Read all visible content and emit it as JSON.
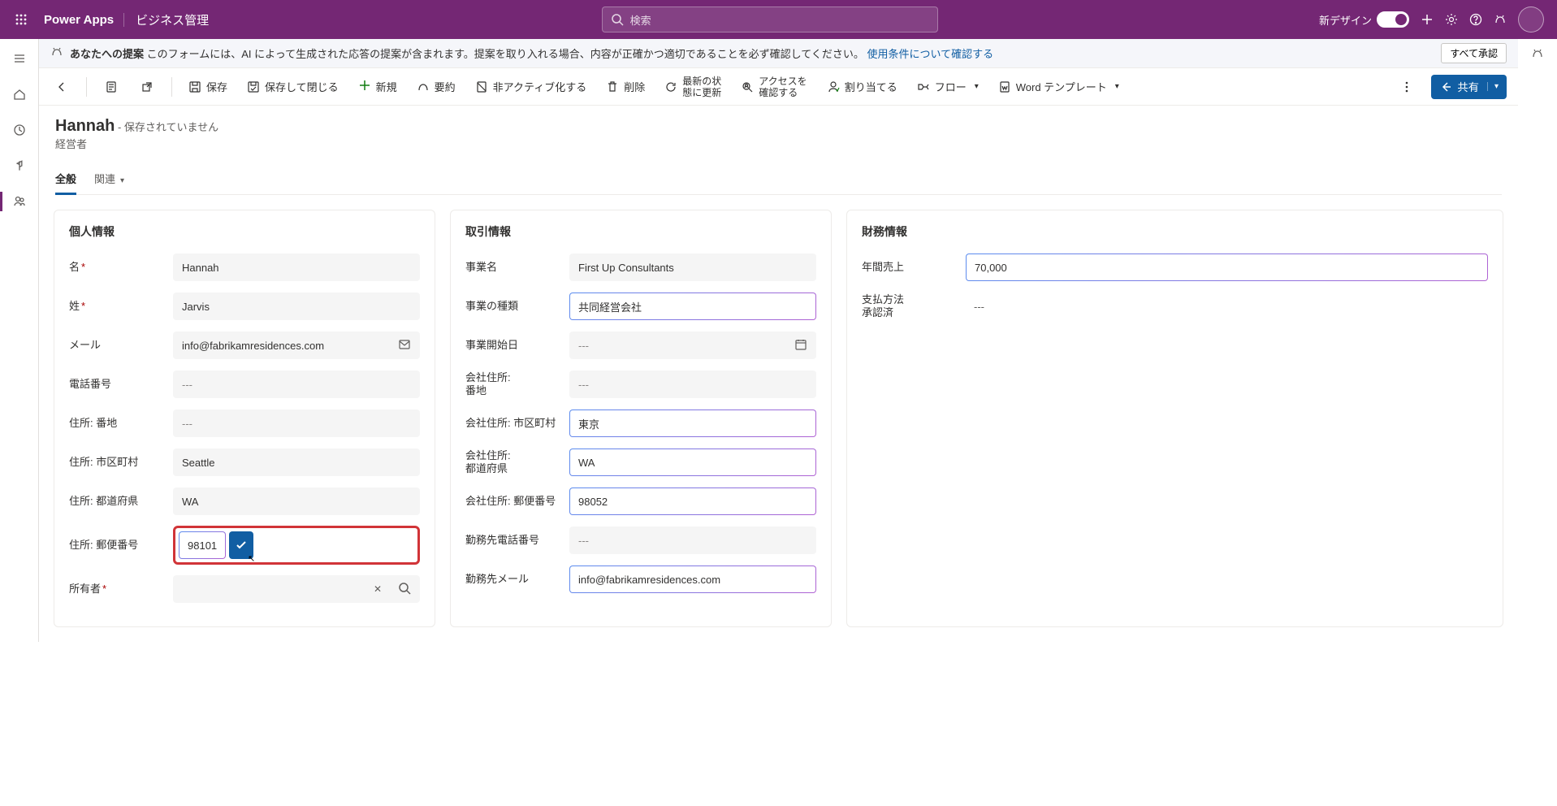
{
  "topbar": {
    "brand": "Power Apps",
    "app_name": "ビジネス管理",
    "search_placeholder": "検索",
    "new_design_label": "新デザイン"
  },
  "suggestion_bar": {
    "prefix_bold": "あなたへの提案",
    "text": " このフォームには、AI によって生成された応答の提案が含まれます。提案を取り入れる場合、内容が正確かつ適切であることを必ず確認してください。",
    "link": "使用条件について確認する",
    "approve_all": "すべて承認"
  },
  "commandbar": {
    "save": "保存",
    "save_close": "保存して閉じる",
    "new": "新規",
    "summary": "要約",
    "deactivate": "非アクティブ化する",
    "delete": "削除",
    "refresh_l1": "最新の状",
    "refresh_l2": "態に更新",
    "access_l1": "アクセスを",
    "access_l2": "確認する",
    "assign": "割り当てる",
    "flow": "フロー",
    "word": "Word テンプレート",
    "share": "共有"
  },
  "record": {
    "title": "Hannah",
    "saved_suffix": " - 保存されていません",
    "subtitle": "経営者"
  },
  "tabs": {
    "general": "全般",
    "related": "関連"
  },
  "sections": {
    "personal": {
      "title": "個人情報",
      "fields": {
        "first_name": {
          "label": "名",
          "value": "Hannah",
          "required": true
        },
        "last_name": {
          "label": "姓",
          "value": "Jarvis",
          "required": true
        },
        "email": {
          "label": "メール",
          "value": "info@fabrikamresidences.com"
        },
        "phone": {
          "label": "電話番号",
          "value": "---"
        },
        "addr_street": {
          "label": "住所: 番地",
          "value": "---"
        },
        "addr_city": {
          "label": "住所: 市区町村",
          "value": "Seattle"
        },
        "addr_state": {
          "label": "住所: 都道府県",
          "value": "WA"
        },
        "addr_zip": {
          "label": "住所: 郵便番号",
          "value": "98101"
        },
        "owner": {
          "label": "所有者",
          "required": true
        }
      }
    },
    "transaction": {
      "title": "取引情報",
      "fields": {
        "biz_name": {
          "label": "事業名",
          "value": "First Up Consultants"
        },
        "biz_type": {
          "label": "事業の種類",
          "value": "共同経営会社"
        },
        "biz_start": {
          "label": "事業開始日",
          "value": "---"
        },
        "co_street_l1": "会社住所:",
        "co_street_l2": "番地",
        "co_street_v": "---",
        "co_city": {
          "label": "会社住所: 市区町村",
          "value": "東京"
        },
        "co_state_l1": "会社住所:",
        "co_state_l2": "都道府県",
        "co_state_v": "WA",
        "co_zip": {
          "label": "会社住所: 郵便番号",
          "value": "98052"
        },
        "work_phone": {
          "label": "勤務先電話番号",
          "value": "---"
        },
        "work_email": {
          "label": "勤務先メール",
          "value": "info@fabrikamresidences.com"
        }
      }
    },
    "finance": {
      "title": "財務情報",
      "fields": {
        "revenue": {
          "label": "年間売上",
          "value": "70,000"
        },
        "pay_l1": "支払方法",
        "pay_l2": "承認済",
        "pay_v": "---"
      }
    }
  }
}
